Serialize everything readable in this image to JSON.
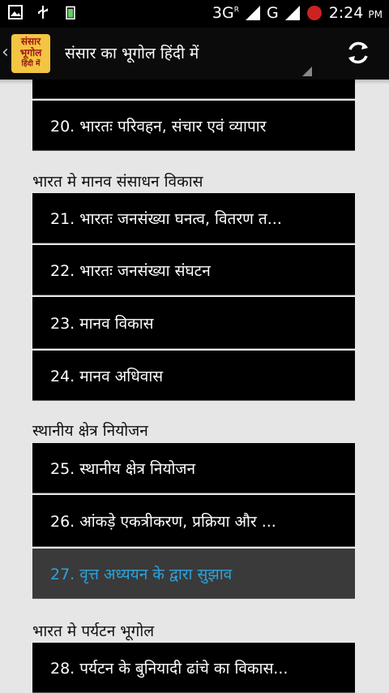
{
  "status": {
    "network": "3G",
    "network_sup": "R",
    "network2": "G",
    "time": "2:24",
    "ampm": "PM"
  },
  "app": {
    "title": "संसार का भूगोल हिंदी में",
    "logo_line1": "संसार",
    "logo_line2": "भूगोल",
    "logo_line3": "हिंदी में"
  },
  "list": {
    "item20": "20. भारतः परिवहन, संचार एवं व्यापार",
    "section1": "भारत मे मानव संसाधन विकास",
    "item21": "21. भारतः जनसंख्या घनत्व, वितरण त...",
    "item22": "22. भारतः जनसंख्या संघटन",
    "item23": "23. मानव विकास",
    "item24": "24. मानव अधिवास",
    "section2": "स्थानीय क्षेत्र नियोजन",
    "item25": "25. स्थानीय क्षेत्र नियोजन",
    "item26": "26. आंकड़े एकत्रीकरण, प्रक्रिया और ...",
    "item27": "27. वृत्त अध्ययन के द्वारा सुझाव",
    "section3": "भारत मे पर्यटन भूगोल",
    "item28": "28. पर्यटन के बुनियादी ढांचे का विकास..."
  },
  "icons": [
    "image-icon",
    "usb-icon",
    "battery-icon",
    "signal-icon",
    "refresh-icon",
    "back-chevron-icon"
  ],
  "colors": {
    "selected_text": "#2aa4e0",
    "item_bg": "#000000",
    "list_bg": "#e6e6e6"
  }
}
